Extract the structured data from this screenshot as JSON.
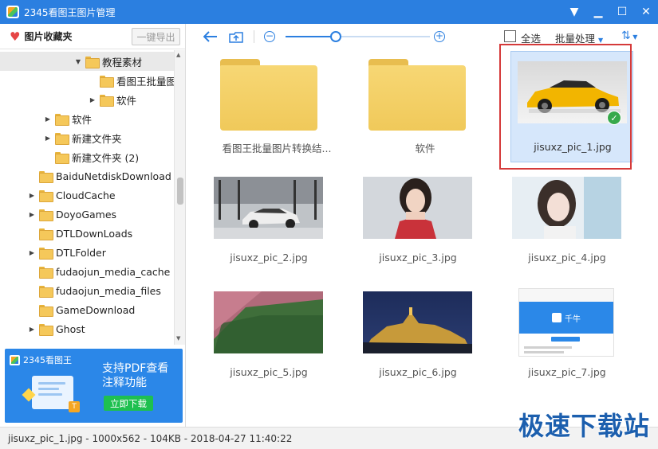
{
  "titlebar": {
    "title": "2345看图王图片管理"
  },
  "sidebar": {
    "fav_title": "图片收藏夹",
    "export_label": "一键导出",
    "tree": [
      {
        "label": "教程素材",
        "expand": "expanded"
      },
      {
        "label": "看图王批量图",
        "expand": "none"
      },
      {
        "label": "软件",
        "expand": "collapsed"
      },
      {
        "label": "软件",
        "expand": "collapsed"
      },
      {
        "label": "新建文件夹",
        "expand": "collapsed"
      },
      {
        "label": "新建文件夹 (2)",
        "expand": "none"
      },
      {
        "label": "BaiduNetdiskDownload",
        "expand": "none"
      },
      {
        "label": "CloudCache",
        "expand": "collapsed"
      },
      {
        "label": "DoyoGames",
        "expand": "collapsed"
      },
      {
        "label": "DTLDownLoads",
        "expand": "none"
      },
      {
        "label": "DTLFolder",
        "expand": "collapsed"
      },
      {
        "label": "fudaojun_media_cache",
        "expand": "none"
      },
      {
        "label": "fudaojun_media_files",
        "expand": "none"
      },
      {
        "label": "GameDownload",
        "expand": "none"
      },
      {
        "label": "Ghost",
        "expand": "collapsed"
      }
    ]
  },
  "ad": {
    "brand": "2345看图王",
    "line1": "支持PDF查看",
    "line2": "注释功能",
    "button": "立即下载"
  },
  "toolbar": {
    "select_all": "全选",
    "batch": "批量处理",
    "zoom_level": 0.35
  },
  "grid": {
    "items": [
      {
        "name": "看图王批量图片转换结...",
        "kind": "folder"
      },
      {
        "name": "软件",
        "kind": "folder"
      },
      {
        "name": "jisuxz_pic_1.jpg",
        "kind": "image",
        "selected": true
      },
      {
        "name": "jisuxz_pic_2.jpg",
        "kind": "image"
      },
      {
        "name": "jisuxz_pic_3.jpg",
        "kind": "image"
      },
      {
        "name": "jisuxz_pic_4.jpg",
        "kind": "image"
      },
      {
        "name": "jisuxz_pic_5.jpg",
        "kind": "image"
      },
      {
        "name": "jisuxz_pic_6.jpg",
        "kind": "image"
      },
      {
        "name": "jisuxz_pic_7.jpg",
        "kind": "image"
      }
    ]
  },
  "thumb7": {
    "logo_text": "千牛"
  },
  "status": {
    "text": "jisuxz_pic_1.jpg - 1000x562 - 104KB - 2018-04-27 11:40:22"
  },
  "watermark": "极速下载站",
  "colors": {
    "accent": "#2b7fe0",
    "selection_border": "#d53a3a"
  }
}
